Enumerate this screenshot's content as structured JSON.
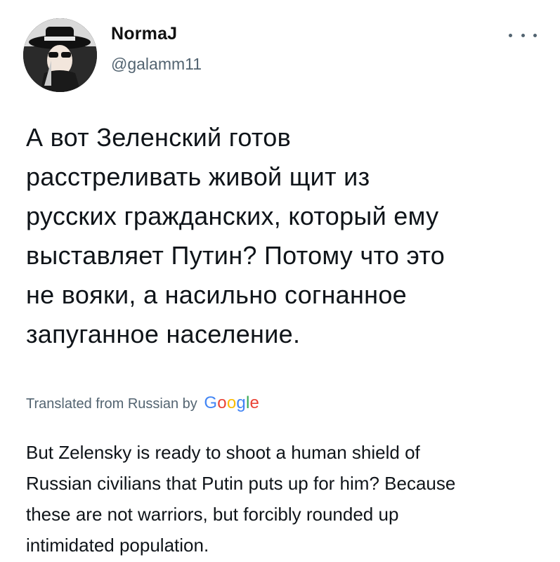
{
  "author": {
    "name": "NormaJ",
    "handle": "@galamm11"
  },
  "more_icon": "more-horizontal-icon",
  "tweet": {
    "lines": [
      "А вот Зеленский готов",
      "расстреливать живой щит из",
      "русских гражданских, который ему",
      "выставляет Путин?  Потому что это",
      "не вояки, а насильно согнанное",
      "запуганное население."
    ]
  },
  "translation_notice": {
    "prefix": "Translated from Russian by",
    "provider": "Google",
    "provider_colors": [
      "#4285F4",
      "#EA4335",
      "#FBBC05",
      "#4285F4",
      "#34A853",
      "#EA4335"
    ]
  },
  "translation": {
    "lines": [
      "But Zelensky is ready to shoot a human shield of",
      "Russian civilians that Putin puts up for him? Because",
      "these are not warriors, but forcibly rounded up",
      "intimidated population."
    ]
  }
}
